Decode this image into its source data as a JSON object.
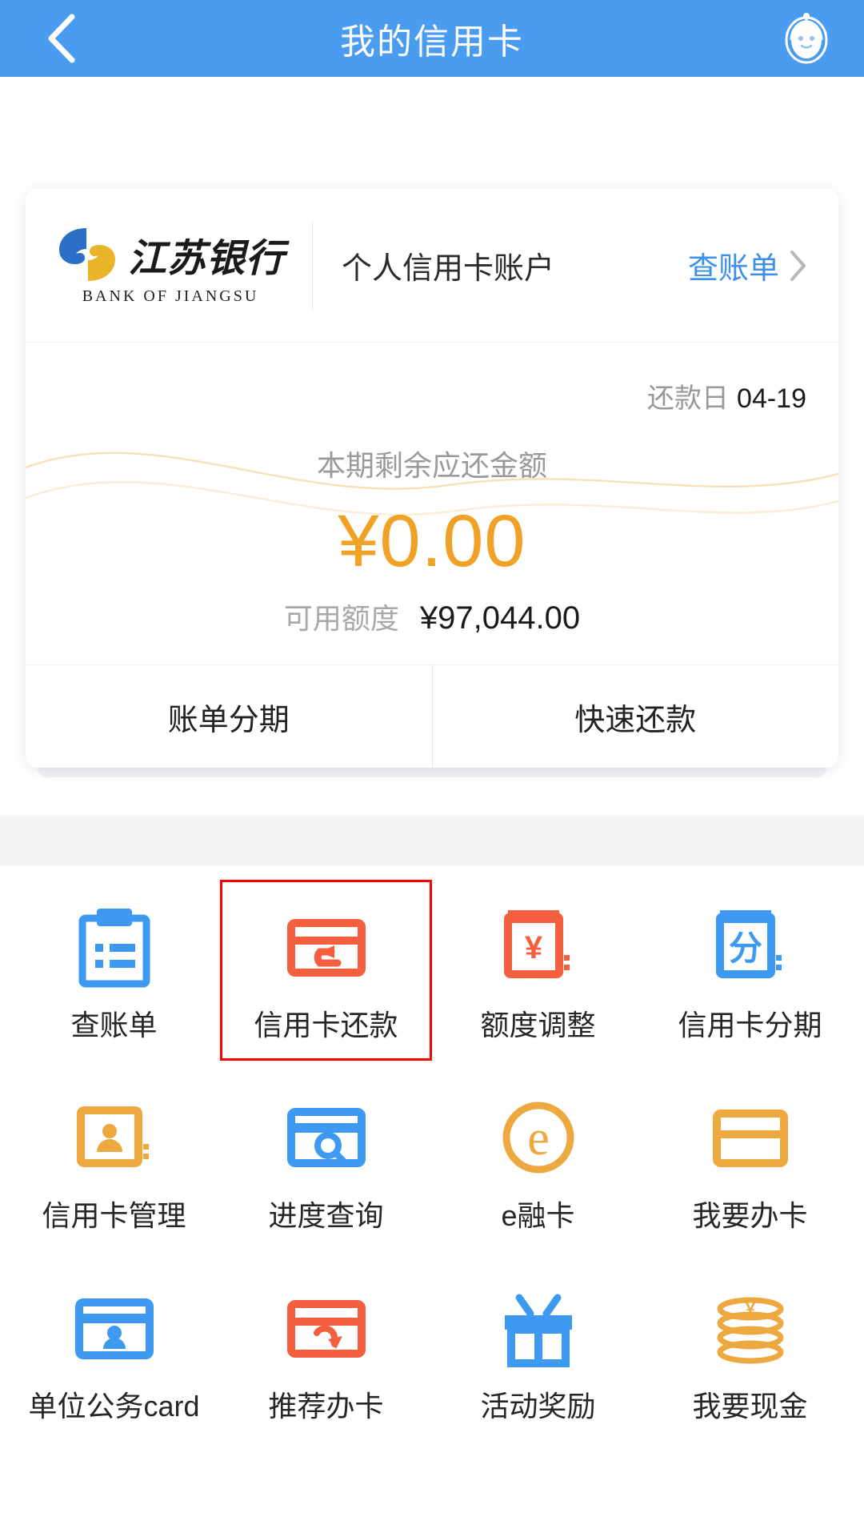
{
  "header": {
    "title": "我的信用卡",
    "back_icon": "chevron-left-icon",
    "assistant_icon": "robot-assistant-icon"
  },
  "card": {
    "logo": {
      "name_cn": "江苏银行",
      "name_en": "BANK OF JIANGSU",
      "mark_icon": "jiangsu-bank-swirl-logo",
      "colors": {
        "blue": "#2A6FC4",
        "yellow": "#E8B42A"
      }
    },
    "account_label": "个人信用卡账户",
    "statement_link": "查账单",
    "statement_chevron_icon": "chevron-right-icon",
    "due_date_label": "还款日",
    "due_date_value": "04-19",
    "amount_title": "本期剩余应还金额",
    "amount_value": "¥0.00",
    "amount_color": "#F0A226",
    "available_label": "可用额度",
    "available_value": "¥97,044.00",
    "actions": [
      {
        "label": "账单分期"
      },
      {
        "label": "快速还款"
      }
    ]
  },
  "grid": {
    "selection_color": "#FF0000",
    "items": [
      {
        "label": "查账单",
        "icon": "clipboard-list-icon",
        "color": "#3D9AF0",
        "selected": false
      },
      {
        "label": "信用卡还款",
        "icon": "card-repay-arrow-icon",
        "color": "#F4603F",
        "selected": true
      },
      {
        "label": "额度调整",
        "icon": "yuan-in-frame-icon",
        "color": "#F4603F",
        "selected": false
      },
      {
        "label": "信用卡分期",
        "icon": "fen-in-frame-icon",
        "color": "#3D9AF0",
        "selected": false
      },
      {
        "label": "信用卡管理",
        "icon": "person-card-icon",
        "color": "#EDA840",
        "selected": false
      },
      {
        "label": "进度查询",
        "icon": "card-search-icon",
        "color": "#3D9AF0",
        "selected": false
      },
      {
        "label": "e融卡",
        "icon": "e-letter-circle-icon",
        "color": "#EDA840",
        "selected": false
      },
      {
        "label": "我要办卡",
        "icon": "blank-card-icon",
        "color": "#EDA840",
        "selected": false
      },
      {
        "label": "单位公务card",
        "icon": "corporate-card-icon",
        "color": "#3D9AF0",
        "selected": false
      },
      {
        "label": "推荐办卡",
        "icon": "card-share-arrow-icon",
        "color": "#F4603F",
        "selected": false
      },
      {
        "label": "活动奖励",
        "icon": "gift-box-icon",
        "color": "#3D9AF0",
        "selected": false
      },
      {
        "label": "我要现金",
        "icon": "coins-stack-icon",
        "color": "#EDA840",
        "selected": false
      }
    ]
  }
}
